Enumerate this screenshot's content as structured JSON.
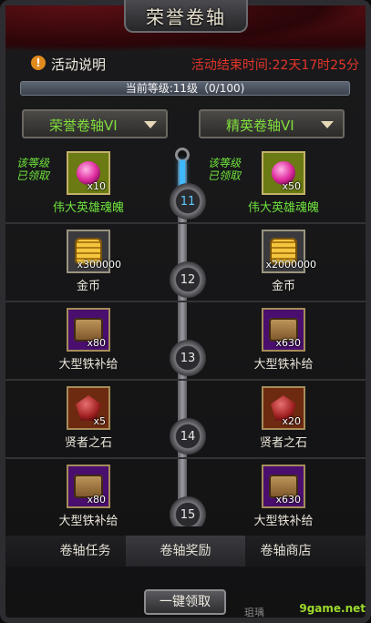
{
  "title": "荣誉卷轴",
  "info": {
    "icon": "info-icon",
    "label": "活动说明",
    "end_time": "活动结束时间:22天17时25分"
  },
  "level": {
    "text": "当前等级:11级（0/100)",
    "progress": 0.0
  },
  "selectors": {
    "left": "荣誉卷轴VI",
    "right": "精英卷轴VI"
  },
  "rows": [
    {
      "level": "11",
      "active": true,
      "left": {
        "qty": "x10",
        "name": "伟大英雄魂魄",
        "claimed": "该等级\n已领取",
        "icon": "soul-gem-icon"
      },
      "right": {
        "qty": "x50",
        "name": "伟大英雄魂魄",
        "claimed": "该等级\n已领取",
        "icon": "soul-gem-icon"
      }
    },
    {
      "level": "12",
      "left": {
        "qty": "x300000",
        "name": "金币",
        "icon": "gold-coins-icon"
      },
      "right": {
        "qty": "x2000000",
        "name": "金币",
        "icon": "gold-coins-icon"
      }
    },
    {
      "level": "13",
      "left": {
        "qty": "x80",
        "name": "大型铁补给",
        "icon": "iron-chest-icon"
      },
      "right": {
        "qty": "x630",
        "name": "大型铁补给",
        "icon": "iron-chest-icon"
      }
    },
    {
      "level": "14",
      "left": {
        "qty": "x5",
        "name": "贤者之石",
        "icon": "sage-stone-icon"
      },
      "right": {
        "qty": "x20",
        "name": "贤者之石",
        "icon": "sage-stone-icon"
      }
    },
    {
      "level": "15",
      "left": {
        "qty": "x80",
        "name": "大型铁补给",
        "icon": "iron-chest-icon"
      },
      "right": {
        "qty": "x630",
        "name": "大型铁补给",
        "icon": "iron-chest-icon"
      }
    }
  ],
  "tabs": [
    "卷轴任务",
    "卷轴奖励",
    "卷轴商店"
  ],
  "claim_all": "一键领取",
  "watermark": "9game.net",
  "watermark_cn": "珇瑀"
}
